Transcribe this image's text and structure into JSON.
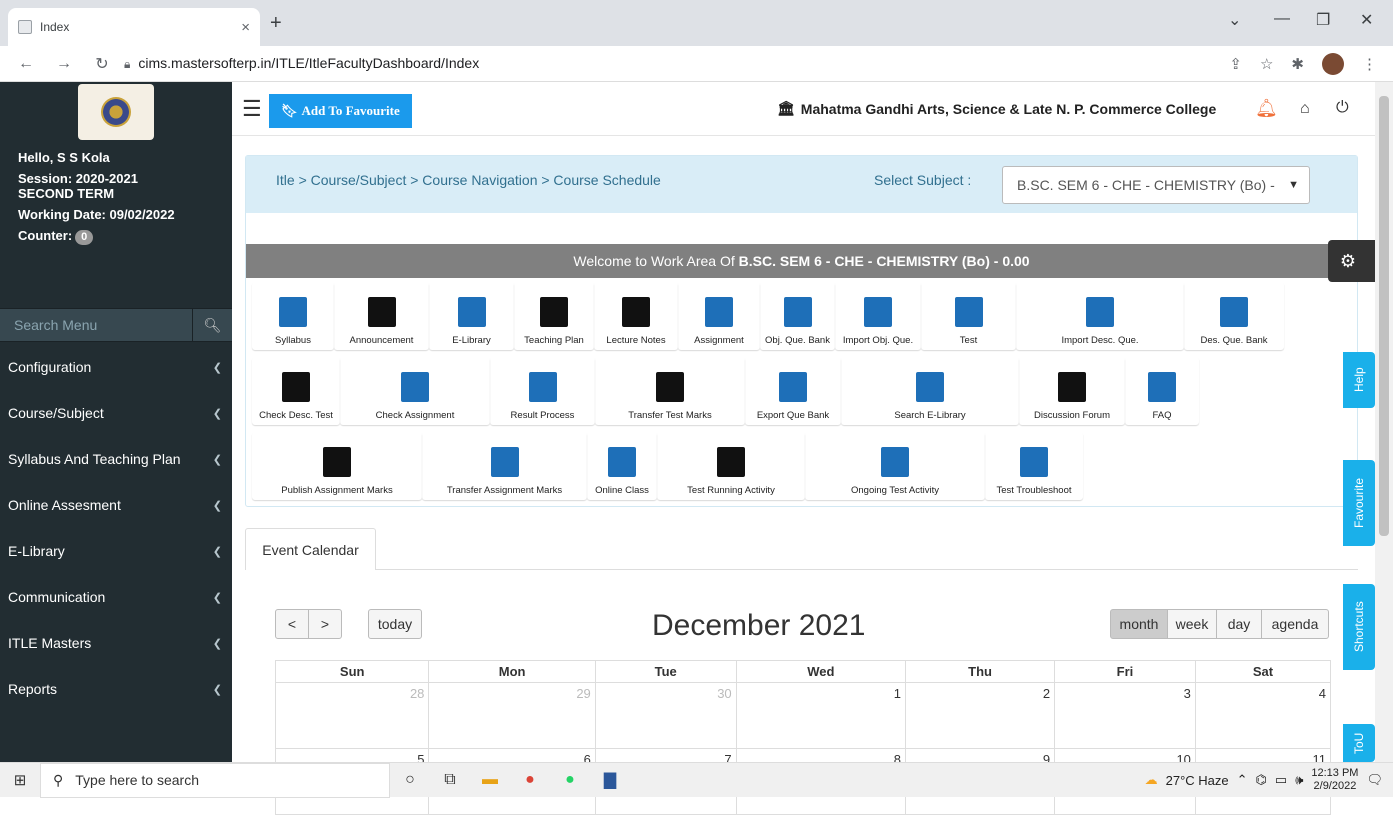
{
  "browser": {
    "tab_title": "Index",
    "url": "cims.mastersofterp.in/ITLE/ItleFacultyDashboard/Index"
  },
  "sidebar": {
    "greeting": "Hello, S S Kola",
    "session": "Session: 2020-2021",
    "term": "SECOND TERM",
    "working_date": "Working Date: 09/02/2022",
    "counter_label": "Counter:",
    "counter_value": "0",
    "search_placeholder": "Search Menu",
    "items": [
      {
        "label": "Configuration"
      },
      {
        "label": "Course/Subject"
      },
      {
        "label": "Syllabus And Teaching Plan"
      },
      {
        "label": "Online Assesment"
      },
      {
        "label": "E-Library"
      },
      {
        "label": "Communication"
      },
      {
        "label": "ITLE Masters"
      },
      {
        "label": "Reports"
      }
    ]
  },
  "header": {
    "favourite_button": "Add To Favourite",
    "college_name": "Mahatma Gandhi Arts, Science & Late N. P. Commerce College"
  },
  "breadcrumb": "Itle > Course/Subject > Course Navigation > Course Schedule",
  "subject_select": {
    "label": "Select Subject :",
    "value": "B.SC. SEM 6 - CHE - CHEMISTRY (Bo) -"
  },
  "welcome": {
    "prefix": "Welcome to Work Area Of",
    "subject": "B.SC. SEM 6 - CHE - CHEMISTRY (Bo) - 0.00"
  },
  "tiles": {
    "row1": [
      "Syllabus",
      "Announcement",
      "E-Library",
      "Teaching Plan",
      "Lecture Notes",
      "Assignment",
      "Obj. Que. Bank",
      "Import Obj. Que.",
      "Test",
      "Import Desc. Que.",
      "Des. Que. Bank"
    ],
    "row2": [
      "Check Desc. Test",
      "Check Assignment",
      "Result Process",
      "Transfer Test Marks",
      "Export Que Bank",
      "Search E-Library",
      "Discussion Forum",
      "FAQ"
    ],
    "row3": [
      "Publish Assignment Marks",
      "Transfer Assignment Marks",
      "Online Class",
      "Test Running Activity",
      "Ongoing Test Activity",
      "Test Troubleshoot"
    ]
  },
  "side_tabs": {
    "help": "Help",
    "favourite": "Favourite",
    "shortcuts": "Shortcuts",
    "tou": "ToU"
  },
  "calendar": {
    "tab_label": "Event Calendar",
    "prev": "<",
    "next": ">",
    "today": "today",
    "title": "December 2021",
    "views": [
      "month",
      "week",
      "day",
      "agenda"
    ],
    "active_view": "month",
    "days": [
      "Sun",
      "Mon",
      "Tue",
      "Wed",
      "Thu",
      "Fri",
      "Sat"
    ],
    "week1": [
      "28",
      "29",
      "30",
      "1",
      "2",
      "3",
      "4"
    ],
    "week2": [
      "5",
      "6",
      "7",
      "8",
      "9",
      "10",
      "11"
    ]
  },
  "taskbar": {
    "search_placeholder": "Type here to search",
    "weather": "27°C  Haze",
    "time": "12:13 PM",
    "date": "2/9/2022"
  }
}
